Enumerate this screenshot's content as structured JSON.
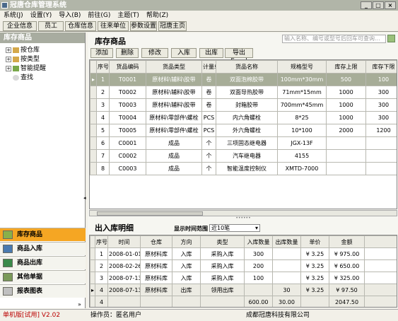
{
  "window": {
    "title": "冠唐仓库管理系统"
  },
  "menu": [
    "系统(J)",
    "设置(Y)",
    "导入(B)",
    "前往(G)",
    "主题(T)",
    "帮助(Z)"
  ],
  "toolbar": [
    "企业信息",
    "员工",
    "仓库信息",
    "往来单位",
    "参数设置",
    "冠唐主页"
  ],
  "left_panel": {
    "title": "库存商品",
    "tree": [
      "按仓库",
      "按类型",
      "智能提醒",
      "查找"
    ],
    "nav": [
      "库存商品",
      "商品入库",
      "商品出库",
      "其他单据",
      "报表图表"
    ]
  },
  "inventory": {
    "title": "库存商品",
    "search_placeholder": "输入名称、编号或型号后回车可查询...",
    "actions": [
      "添加",
      "删除",
      "修改",
      "入库",
      "出库",
      "导出Excel"
    ],
    "headers": [
      "序号",
      "货品编码",
      "货品类型",
      "计量单位",
      "货品名称",
      "规格型号",
      "库存上限",
      "库存下限"
    ],
    "rows": [
      [
        "1",
        "T0001",
        "原材料\\辅料\\胶带",
        "卷",
        "双面泡棉胶带",
        "100mm*30mm",
        "500",
        "100"
      ],
      [
        "2",
        "T0002",
        "原材料\\辅料\\胶带",
        "卷",
        "双面导热胶带",
        "71mm*15mm",
        "1000",
        "300"
      ],
      [
        "3",
        "T0003",
        "原材料\\辅料\\胶带",
        "卷",
        "封箱胶带",
        "700mm*45mm",
        "1000",
        "300"
      ],
      [
        "4",
        "T0004",
        "原材料\\零部件\\螺栓",
        "PCS",
        "内六角螺栓",
        "8*25",
        "1000",
        "300"
      ],
      [
        "5",
        "T0005",
        "原材料\\零部件\\螺栓",
        "PCS",
        "外六角螺栓",
        "10*100",
        "2000",
        "1200"
      ],
      [
        "6",
        "C0001",
        "成品",
        "个",
        "三项固态继电器",
        "JGX-13F",
        "",
        ""
      ],
      [
        "7",
        "C0002",
        "成品",
        "个",
        "汽车继电器",
        "4155",
        "",
        ""
      ],
      [
        "8",
        "C0003",
        "成品",
        "个",
        "智能温度控制仪",
        "XMTD-7000",
        "",
        ""
      ]
    ]
  },
  "ledger": {
    "title": "出入库明细",
    "range_label": "显示时间范围",
    "range_value": "近10笔",
    "headers": [
      "序号",
      "时间",
      "仓库",
      "方向",
      "类型",
      "入库数量",
      "出库数量",
      "单价",
      "金额"
    ],
    "rows": [
      [
        "1",
        "2008-01-01",
        "原材料库",
        "入库",
        "采购入库",
        "300",
        "",
        "¥ 3.25",
        "¥ 975.00"
      ],
      [
        "2",
        "2008-02-26",
        "原材料库",
        "入库",
        "采购入库",
        "200",
        "",
        "¥ 3.25",
        "¥ 650.00"
      ],
      [
        "3",
        "2008-07-13",
        "原材料库",
        "入库",
        "采购入库",
        "100",
        "",
        "¥ 3.25",
        "¥ 325.00"
      ],
      [
        "4",
        "2008-07-13",
        "原材料库",
        "出库",
        "领用出库",
        "",
        "30",
        "¥ 3.25",
        "¥ 97.50"
      ]
    ],
    "totals": {
      "count": "4",
      "in_qty": "600.00",
      "out_qty": "30.00",
      "amount": "2047.50"
    }
  },
  "status": {
    "version": "单机版[试用]  V2.02",
    "operator": "操作员：匿名用户",
    "company": "成都冠唐科技有限公司"
  }
}
